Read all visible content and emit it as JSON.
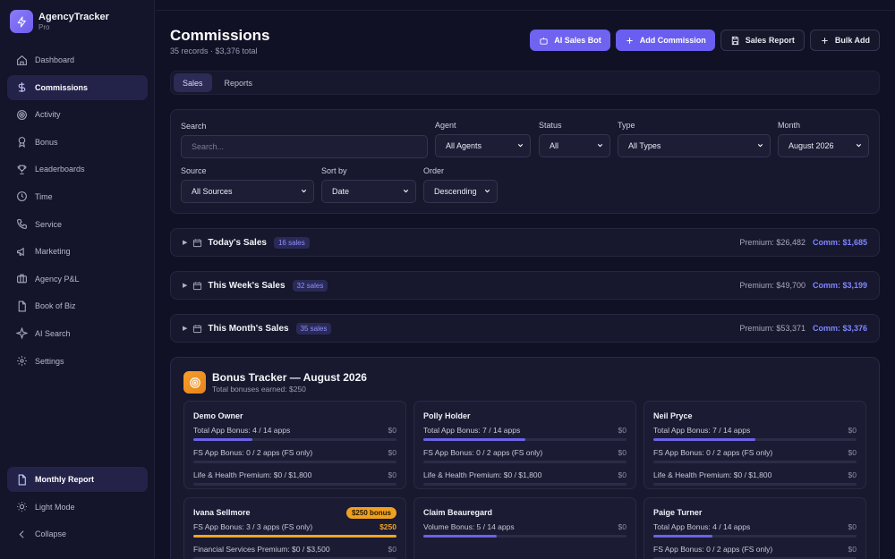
{
  "app": {
    "name": "AgencyTracker",
    "plan": "Pro"
  },
  "sidebar": {
    "items": [
      {
        "label": "Dashboard",
        "icon": "home-icon",
        "active": false
      },
      {
        "label": "Commissions",
        "icon": "dollar-icon",
        "active": true
      },
      {
        "label": "Activity",
        "icon": "target-icon",
        "active": false
      },
      {
        "label": "Bonus",
        "icon": "award-icon",
        "active": false
      },
      {
        "label": "Leaderboards",
        "icon": "trophy-icon",
        "active": false
      },
      {
        "label": "Time",
        "icon": "clock-icon",
        "active": false
      },
      {
        "label": "Service",
        "icon": "phone-icon",
        "active": false
      },
      {
        "label": "Marketing",
        "icon": "megaphone-icon",
        "active": false
      },
      {
        "label": "Agency P&L",
        "icon": "briefcase-icon",
        "active": false
      },
      {
        "label": "Book of Biz",
        "icon": "file-icon",
        "active": false
      },
      {
        "label": "AI Search",
        "icon": "sparkle-icon",
        "active": false
      },
      {
        "label": "Settings",
        "icon": "gear-icon",
        "active": false
      }
    ],
    "bottom": {
      "monthly_report": "Monthly Report",
      "light_mode": "Light Mode",
      "collapse": "Collapse"
    }
  },
  "header": {
    "title": "Commissions",
    "subtitle": "35 records · $3,376 total",
    "buttons": {
      "ai_bot": "AI Sales Bot",
      "add": "Add Commission",
      "report": "Sales Report",
      "bulk": "Bulk Add"
    }
  },
  "tabs": [
    "Sales",
    "Reports"
  ],
  "filters": {
    "search_label": "Search",
    "search_placeholder": "Search...",
    "agent_label": "Agent",
    "agent_value": "All Agents",
    "status_label": "Status",
    "status_value": "All",
    "type_label": "Type",
    "type_value": "All Types",
    "month_label": "Month",
    "month_value": "August 2026",
    "source_label": "Source",
    "source_value": "All Sources",
    "sort_label": "Sort by",
    "sort_value": "Date",
    "order_label": "Order",
    "order_value": "Descending"
  },
  "groups": [
    {
      "title": "Today's Sales",
      "badge": "16 sales",
      "premium": "Premium: $26,482",
      "comm": "Comm: $1,685"
    },
    {
      "title": "This Week's Sales",
      "badge": "32 sales",
      "premium": "Premium: $49,700",
      "comm": "Comm: $3,199"
    },
    {
      "title": "This Month's Sales",
      "badge": "35 sales",
      "premium": "Premium: $53,371",
      "comm": "Comm: $3,376"
    }
  ],
  "bonus": {
    "title": "Bonus Tracker — August 2026",
    "subtitle": "Total bonuses earned: $250",
    "cards": [
      {
        "name": "Demo Owner",
        "rows": [
          {
            "label": "Total App Bonus: 4 / 14 apps",
            "value": "$0",
            "progress": 0.29
          },
          {
            "label": "FS App Bonus: 0 / 2 apps (FS only)",
            "value": "$0",
            "progress": 0
          },
          {
            "label": "Life & Health Premium: $0 / $1,800",
            "value": "$0",
            "progress": 0
          }
        ]
      },
      {
        "name": "Polly Holder",
        "rows": [
          {
            "label": "Total App Bonus: 7 / 14 apps",
            "value": "$0",
            "progress": 0.5
          },
          {
            "label": "FS App Bonus: 0 / 2 apps (FS only)",
            "value": "$0",
            "progress": 0
          },
          {
            "label": "Life & Health Premium: $0 / $1,800",
            "value": "$0",
            "progress": 0
          }
        ]
      },
      {
        "name": "Neil Pryce",
        "rows": [
          {
            "label": "Total App Bonus: 7 / 14 apps",
            "value": "$0",
            "progress": 0.5
          },
          {
            "label": "FS App Bonus: 0 / 2 apps (FS only)",
            "value": "$0",
            "progress": 0
          },
          {
            "label": "Life & Health Premium: $0 / $1,800",
            "value": "$0",
            "progress": 0
          }
        ]
      },
      {
        "name": "Ivana Sellmore",
        "badge": "$250 bonus",
        "rows": [
          {
            "label": "FS App Bonus: 3 / 3 apps (FS only)",
            "value": "$250",
            "progress": 1
          },
          {
            "label": "Financial Services Premium: $0 / $3,500",
            "value": "$0",
            "progress": 0
          }
        ]
      },
      {
        "name": "Claim Beauregard",
        "rows": [
          {
            "label": "Volume Bonus: 5 / 14 apps",
            "value": "$0",
            "progress": 0.36
          }
        ]
      },
      {
        "name": "Paige Turner",
        "rows": [
          {
            "label": "Total App Bonus: 4 / 14 apps",
            "value": "$0",
            "progress": 0.29
          },
          {
            "label": "FS App Bonus: 0 / 2 apps (FS only)",
            "value": "$0",
            "progress": 0
          }
        ]
      }
    ]
  }
}
